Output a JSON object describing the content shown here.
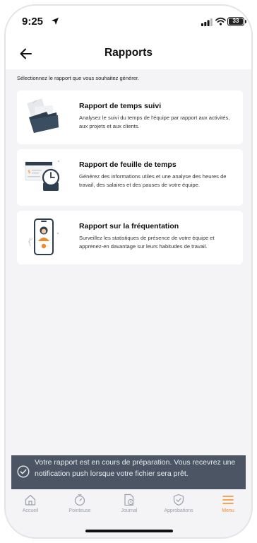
{
  "status_bar": {
    "time": "9:25",
    "battery": "33",
    "icons": [
      "location-arrow-icon",
      "signal-icon",
      "wifi-icon",
      "battery-icon"
    ]
  },
  "header": {
    "title": "Rapports",
    "back_icon": "arrow-left-icon"
  },
  "instructions": "Sélectionnez le rapport que vous souhaitez générer.",
  "reports": [
    {
      "title": "Rapport de temps suivi",
      "description": "Analysez le suivi du temps de l'équipe par rapport aux activités, aux projets et aux clients.",
      "icon": "folder-illustration"
    },
    {
      "title": "Rapport de feuille de temps",
      "description": "Générez des informations utiles et une analyse des heures de travail, des salaires et des pauses de votre équipe.",
      "icon": "timesheet-clock-illustration"
    },
    {
      "title": "Rapport sur la fréquentation",
      "description": "Surveillez les statistiques de présence de votre équipe et apprenez-en davantage sur leurs habitudes de travail.",
      "icon": "phone-attendance-illustration"
    }
  ],
  "toast": {
    "message": "Votre rapport est en cours de préparation. Vous recevrez une notification push lorsque votre fichier sera prêt.",
    "icon": "check-circle-icon"
  },
  "tabbar": {
    "items": [
      {
        "label": "Accueil",
        "icon": "home-icon"
      },
      {
        "label": "Pointeuse",
        "icon": "stopwatch-icon"
      },
      {
        "label": "Journal",
        "icon": "journal-clock-icon"
      },
      {
        "label": "Approbations",
        "icon": "shield-check-icon"
      },
      {
        "label": "Menu",
        "icon": "hamburger-menu-icon"
      }
    ],
    "active": "Menu"
  },
  "colors": {
    "accent": "#f08b2c",
    "toast_bg": "#4b5563",
    "background": "#f4f4f6",
    "card_bg": "#ffffff",
    "illustration_dark": "#2f3e4e"
  }
}
